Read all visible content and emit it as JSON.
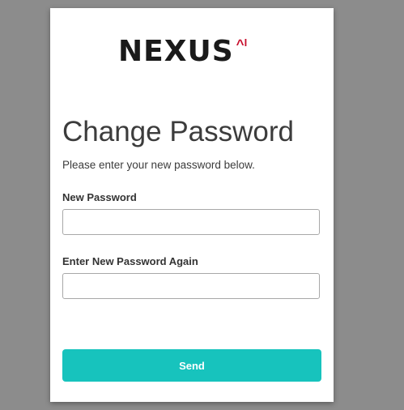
{
  "logo": {
    "wordmark": "NEXUS",
    "superscript_caret": "^",
    "superscript_text": "I",
    "wordmark_color": "#1a1a1a",
    "accent_color": "#c8102e"
  },
  "form": {
    "title": "Change Password",
    "subtitle": "Please enter your new password below.",
    "new_password_label": "New Password",
    "new_password_value": "",
    "confirm_password_label": "Enter New Password Again",
    "confirm_password_value": "",
    "send_label": "Send",
    "send_color": "#17c3bd"
  },
  "page": {
    "background_color": "#8c8c8c",
    "card_color": "#ffffff"
  }
}
